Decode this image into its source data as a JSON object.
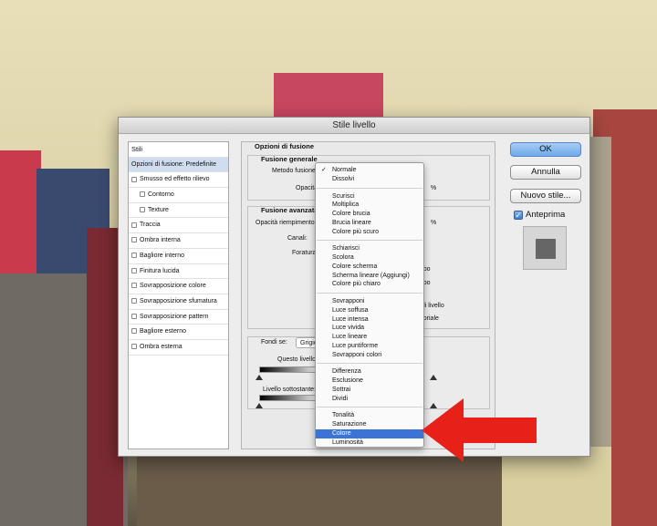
{
  "dialog": {
    "title": "Stile livello",
    "styles_header": "Stili",
    "styles": [
      {
        "label": "Opzioni di fusione: Predefinite",
        "type": "selected"
      },
      {
        "label": "Smusso ed effetto rilievo",
        "type": "check"
      },
      {
        "label": "Contorno",
        "type": "subcheck"
      },
      {
        "label": "Texture",
        "type": "subcheck"
      },
      {
        "label": "Traccia",
        "type": "check"
      },
      {
        "label": "Ombra interna",
        "type": "check"
      },
      {
        "label": "Bagliore interno",
        "type": "check"
      },
      {
        "label": "Finitura lucida",
        "type": "check"
      },
      {
        "label": "Sovrapposizione colore",
        "type": "check"
      },
      {
        "label": "Sovrapposizione sfumatura",
        "type": "check"
      },
      {
        "label": "Sovrapposizione pattern",
        "type": "check"
      },
      {
        "label": "Bagliore esterno",
        "type": "check"
      },
      {
        "label": "Ombra esterna",
        "type": "check"
      }
    ],
    "blend_options": {
      "title": "Opzioni di fusione",
      "general": "Fusione generale",
      "blend_mode_label": "Metodo fusione:",
      "opacity_label": "Opacità:",
      "opacity_unit": "%",
      "advanced": "Fusione avanzata",
      "fill_opacity_label": "Opacità riempimento:",
      "fill_unit": "%",
      "channels_label": "Canali:",
      "knockout_label": "Foratura:",
      "partial_right_1": "uppo",
      "partial_right_2": "uppo",
      "partial_right_3": "a di livello",
      "partial_right_4": "ettoriale",
      "blend_if_label": "Fondi se:",
      "blend_if_value": "Grigio",
      "this_layer_label": "Questo livello:",
      "underlying_label": "Livello sottostante:"
    },
    "buttons": {
      "ok": "OK",
      "cancel": "Annulla",
      "new_style": "Nuovo stile...",
      "preview_label": "Anteprima",
      "preview_checked": true
    }
  },
  "blend_menu": {
    "selected": "Normale",
    "highlighted": "Colore",
    "groups": [
      [
        "Normale",
        "Dissolvi"
      ],
      [
        "Scurisci",
        "Moltiplica",
        "Colore brucia",
        "Brucia lineare",
        "Colore più scuro"
      ],
      [
        "Schiarisci",
        "Scolora",
        "Colore scherma",
        "Scherma lineare (Aggiungi)",
        "Colore più chiaro"
      ],
      [
        "Sovrapponi",
        "Luce soffusa",
        "Luce intensa",
        "Luce vivida",
        "Luce lineare",
        "Luce puntiforme",
        "Sovrapponi colori"
      ],
      [
        "Differenza",
        "Esclusione",
        "Sottrai",
        "Dividi"
      ],
      [
        "Tonalità",
        "Saturazione",
        "Colore",
        "Luminosità"
      ]
    ]
  },
  "colors": {
    "accent": "#3b74d6",
    "arrow": "#e8201a"
  }
}
